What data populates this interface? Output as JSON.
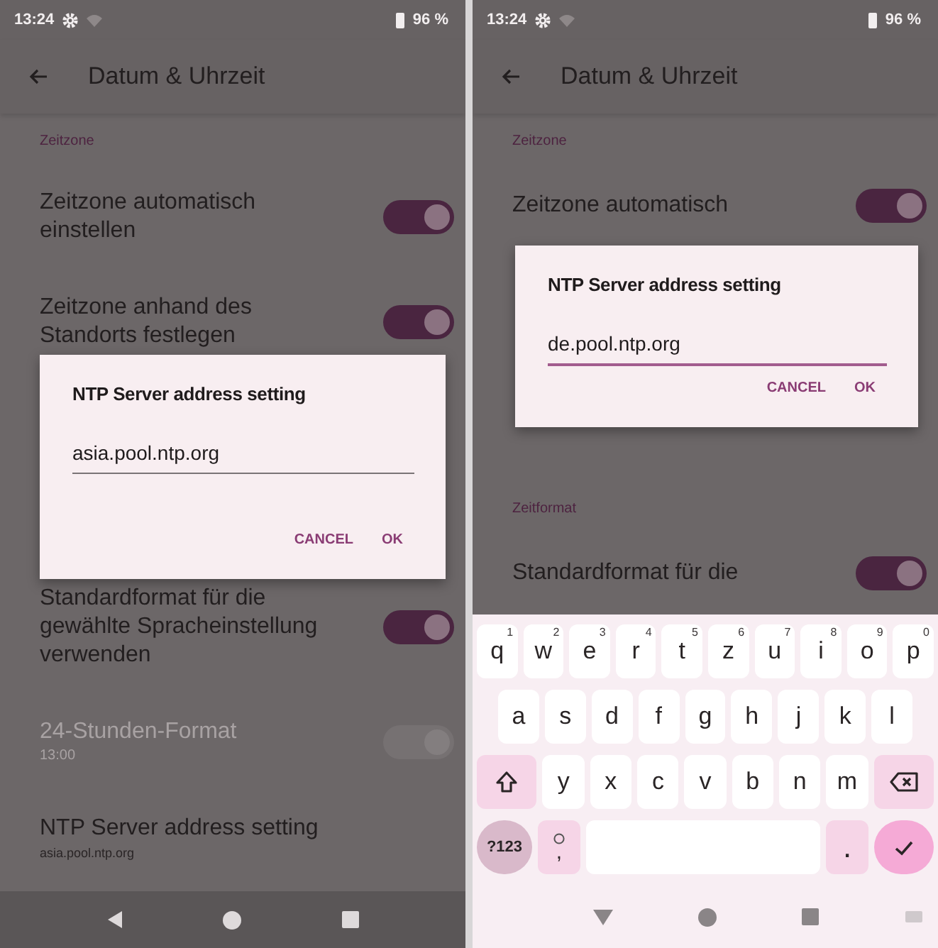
{
  "phones": [
    {
      "status_bar": {
        "time": "13:24",
        "battery": "96 %"
      },
      "toolbar": {
        "title": "Datum & Uhrzeit"
      },
      "content": [
        {
          "kind": "header",
          "text": "Zeitzone"
        },
        {
          "kind": "switch",
          "title": "Zeitzone automatisch einstellen",
          "on": true,
          "disabled": false
        },
        {
          "kind": "switch",
          "title": "Zeitzone anhand des Standorts festlegen",
          "on": true,
          "disabled": false
        },
        {
          "kind": "dialog",
          "title": "NTP Server address setting",
          "field": {
            "value": "asia.pool.ntp.org",
            "focused": false
          },
          "buttons": [
            "CANCEL",
            "OK"
          ]
        },
        {
          "kind": "switch",
          "title": "Standardformat für die gewählte Spracheinstellung verwenden",
          "on": true,
          "disabled": false
        },
        {
          "kind": "switch",
          "title": "24-Stunden-Format",
          "summary": "13:00",
          "on": true,
          "disabled": true
        },
        {
          "kind": "text",
          "title": "NTP Server address setting",
          "summary": "asia.pool.ntp.org"
        }
      ]
    },
    {
      "status_bar": {
        "time": "13:24",
        "battery": "96 %"
      },
      "toolbar": {
        "title": "Datum & Uhrzeit"
      },
      "content": [
        {
          "kind": "header",
          "text": "Zeitzone"
        },
        {
          "kind": "switch",
          "title": "Zeitzone automatisch",
          "on": true,
          "disabled": false
        },
        {
          "kind": "dialog",
          "title": "NTP Server address setting",
          "field": {
            "value": "de.pool.ntp.org",
            "focused": true
          },
          "buttons": [
            "CANCEL",
            "OK"
          ]
        },
        {
          "kind": "header",
          "text": "Zeitformat"
        },
        {
          "kind": "switch",
          "title": "Standardformat für die",
          "on": true,
          "disabled": false
        }
      ],
      "keyboard": {
        "rows": [
          {
            "keys": [
              {
                "kind": "letter",
                "label": "q",
                "hint": "1"
              },
              {
                "kind": "letter",
                "label": "w",
                "hint": "2"
              },
              {
                "kind": "letter",
                "label": "e",
                "hint": "3"
              },
              {
                "kind": "letter",
                "label": "r",
                "hint": "4"
              },
              {
                "kind": "letter",
                "label": "t",
                "hint": "5"
              },
              {
                "kind": "letter",
                "label": "z",
                "hint": "6"
              },
              {
                "kind": "letter",
                "label": "u",
                "hint": "7"
              },
              {
                "kind": "letter",
                "label": "i",
                "hint": "8"
              },
              {
                "kind": "letter",
                "label": "o",
                "hint": "9"
              },
              {
                "kind": "letter",
                "label": "p",
                "hint": "0"
              }
            ]
          },
          {
            "keys": [
              {
                "kind": "letter",
                "label": "a"
              },
              {
                "kind": "letter",
                "label": "s"
              },
              {
                "kind": "letter",
                "label": "d"
              },
              {
                "kind": "letter",
                "label": "f"
              },
              {
                "kind": "letter",
                "label": "g"
              },
              {
                "kind": "letter",
                "label": "h"
              },
              {
                "kind": "letter",
                "label": "j"
              },
              {
                "kind": "letter",
                "label": "k"
              },
              {
                "kind": "letter",
                "label": "l"
              }
            ]
          },
          {
            "keys": [
              {
                "kind": "shift"
              },
              {
                "kind": "letter",
                "label": "y"
              },
              {
                "kind": "letter",
                "label": "x"
              },
              {
                "kind": "letter",
                "label": "c"
              },
              {
                "kind": "letter",
                "label": "v"
              },
              {
                "kind": "letter",
                "label": "b"
              },
              {
                "kind": "letter",
                "label": "n"
              },
              {
                "kind": "letter",
                "label": "m"
              },
              {
                "kind": "backspace"
              }
            ]
          },
          {
            "keys": [
              {
                "kind": "symbols",
                "label": "?123"
              },
              {
                "kind": "comma",
                "label": ","
              },
              {
                "kind": "space"
              },
              {
                "kind": "period",
                "label": "."
              },
              {
                "kind": "enter"
              }
            ]
          }
        ]
      }
    }
  ]
}
